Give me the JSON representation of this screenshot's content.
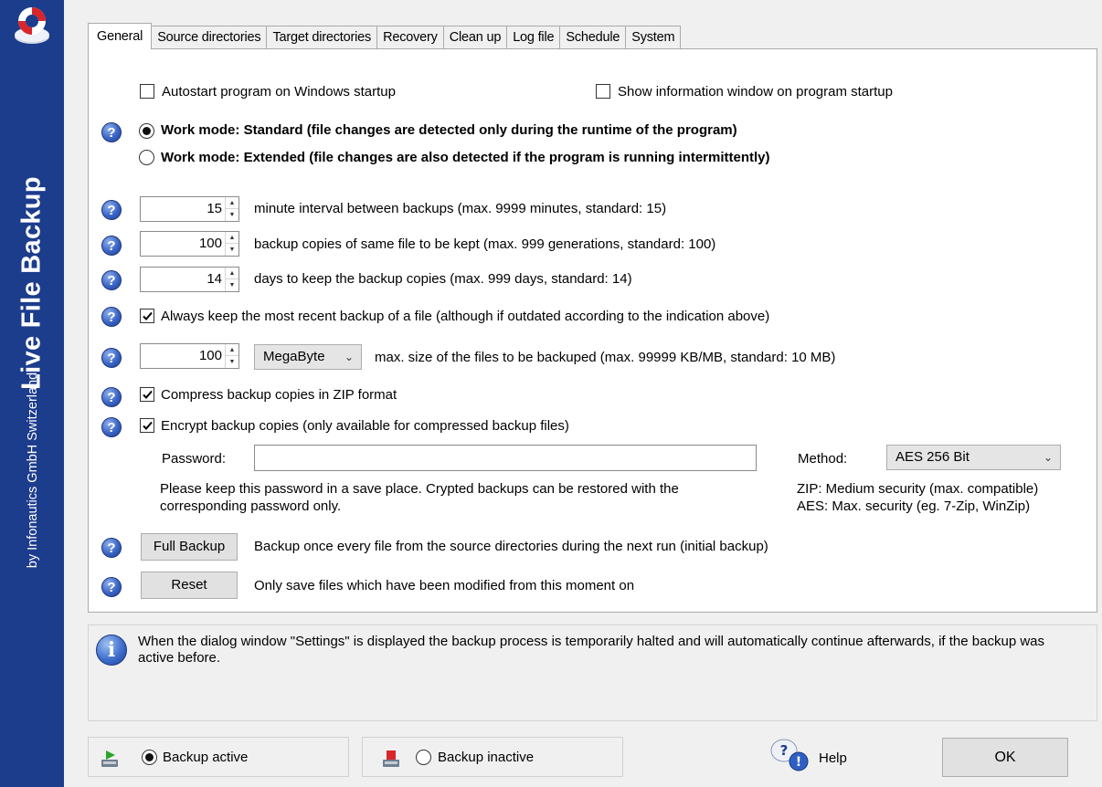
{
  "brand": {
    "title": "Live File Backup",
    "subtitle": "by Infonautics GmbH Switzerland"
  },
  "tabs": [
    {
      "label": "General",
      "active": true
    },
    {
      "label": "Source directories"
    },
    {
      "label": "Target directories"
    },
    {
      "label": "Recovery"
    },
    {
      "label": "Clean up"
    },
    {
      "label": "Log file"
    },
    {
      "label": "Schedule"
    },
    {
      "label": "System"
    }
  ],
  "general": {
    "autostart_label": "Autostart program on Windows startup",
    "autostart_checked": false,
    "show_info_label": "Show information window on program startup",
    "show_info_checked": false,
    "workmode_standard_label": "Work mode: Standard (file changes are detected only during the runtime of the program)",
    "workmode_extended_label": "Work mode: Extended (file changes are also detected if the program is running intermittently)",
    "workmode_selected": "standard",
    "interval_value": "15",
    "interval_label": "minute interval between backups (max. 9999 minutes, standard: 15)",
    "copies_value": "100",
    "copies_label": "backup copies of same file to be kept (max. 999 generations, standard: 100)",
    "days_value": "14",
    "days_label": "days to keep the backup copies (max. 999 days, standard: 14)",
    "keep_recent_label": "Always keep the most recent backup of a file (although if outdated according to the indication above)",
    "keep_recent_checked": true,
    "maxsize_value": "100",
    "maxsize_unit": "MegaByte",
    "maxsize_label": "max. size of the files to be backuped (max. 99999 KB/MB, standard: 10 MB)",
    "compress_label": "Compress backup copies in ZIP format",
    "compress_checked": true,
    "encrypt_label": "Encrypt backup copies (only available for compressed backup files)",
    "encrypt_checked": true,
    "password_label": "Password:",
    "password_value": "",
    "password_note_1": "Please keep this password in a save place. Crypted backups can be restored with the",
    "password_note_2": "corresponding password only.",
    "method_label": "Method:",
    "method_value": "AES 256 Bit",
    "method_note_1": "ZIP: Medium security (max. compatible)",
    "method_note_2": "AES: Max. security (eg. 7-Zip, WinZip)",
    "full_backup_button": "Full Backup",
    "full_backup_desc": "Backup once every file from the source directories during the next run (initial backup)",
    "reset_button": "Reset",
    "reset_desc": "Only save files which have been modified from this moment on",
    "help_glyph": "?"
  },
  "info": {
    "icon": "info-icon",
    "text": "When the dialog window \"Settings\" is displayed the backup process is temporarily halted and will automatically continue afterwards, if the backup was active before."
  },
  "footer": {
    "backup_active_label": "Backup active",
    "backup_inactive_label": "Backup inactive",
    "backup_state": "active",
    "help_label": "Help",
    "ok_label": "OK"
  },
  "colors": {
    "brand_bar": "#1c3c8c",
    "help_icon": "#3a64c4"
  }
}
